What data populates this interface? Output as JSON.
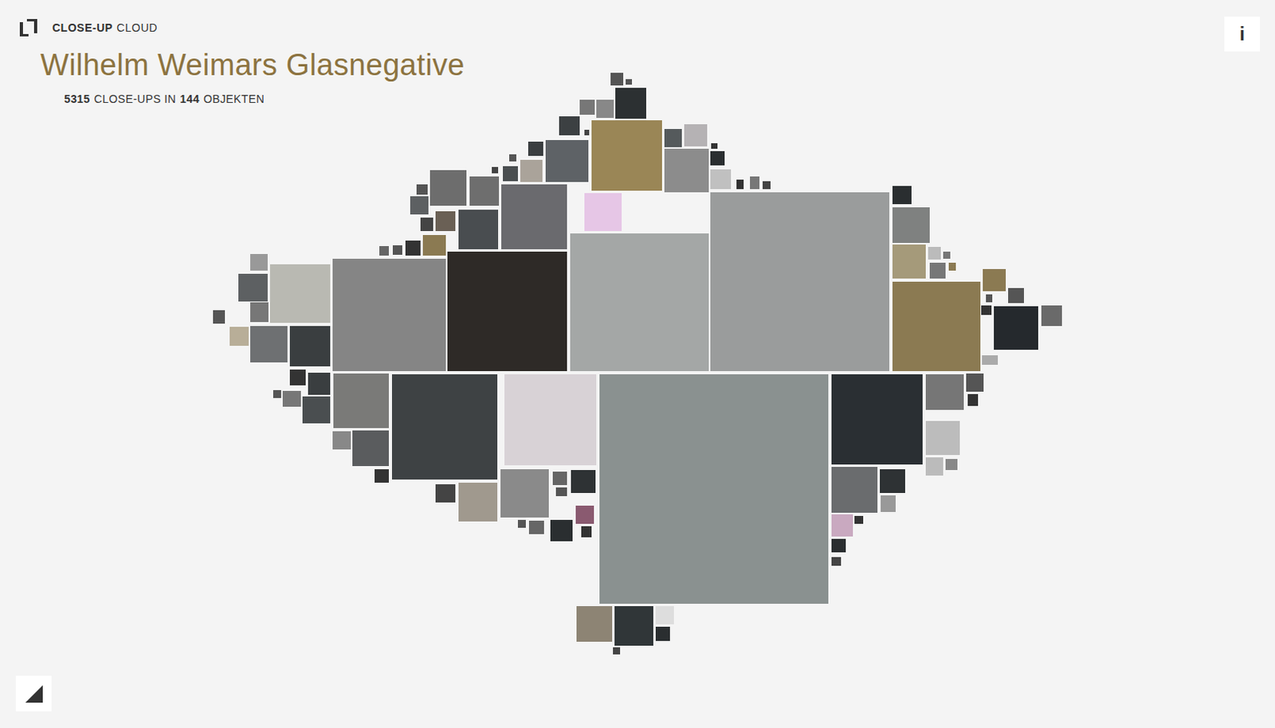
{
  "header": {
    "brand_bold": "CLOSE-UP",
    "brand_light": "CLOUD"
  },
  "title": "Wilhelm Weimars Glasnegative",
  "summary": {
    "closeups": "5315",
    "closeups_label": "CLOSE-UPS IN",
    "objects": "144",
    "objects_label": "OBJEKTEN"
  },
  "info_button": {
    "label": "i"
  }
}
